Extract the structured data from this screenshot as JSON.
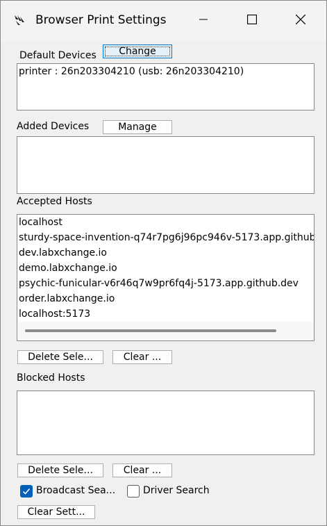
{
  "window": {
    "title": "Browser Print Settings",
    "icons": {
      "app": "zebra-app-icon",
      "minimize": "minimize-icon",
      "maximize": "maximize-icon",
      "close": "close-icon"
    }
  },
  "default_devices": {
    "label": "Default Devices",
    "change_label": "Change",
    "items": [
      "printer : 26n203304210 (usb: 26n203304210)"
    ]
  },
  "added_devices": {
    "label": "Added Devices",
    "manage_label": "Manage",
    "items": []
  },
  "accepted_hosts": {
    "label": "Accepted Hosts",
    "items": [
      "localhost",
      "sturdy-space-invention-q74r7pg6j96pc946v-5173.app.github",
      "dev.labxchange.io",
      "demo.labxchange.io",
      "psychic-funicular-v6r46q7w9pr6fq4j-5173.app.github.dev",
      "order.labxchange.io",
      "localhost:5173"
    ],
    "delete_label": "Delete Sele...",
    "clear_label": "Clear ..."
  },
  "blocked_hosts": {
    "label": "Blocked Hosts",
    "items": [],
    "delete_label": "Delete Sele...",
    "clear_label": "Clear ..."
  },
  "options": {
    "broadcast_search_label": "Broadcast Sea...",
    "broadcast_search_checked": true,
    "driver_search_label": "Driver Search",
    "driver_search_checked": false,
    "clear_settings_label": "Clear Sett..."
  },
  "colors": {
    "accent": "#005fb8",
    "focus_border": "#0078d7",
    "list_bg": "#ffffff",
    "window_bg": "#f0f0f0"
  }
}
